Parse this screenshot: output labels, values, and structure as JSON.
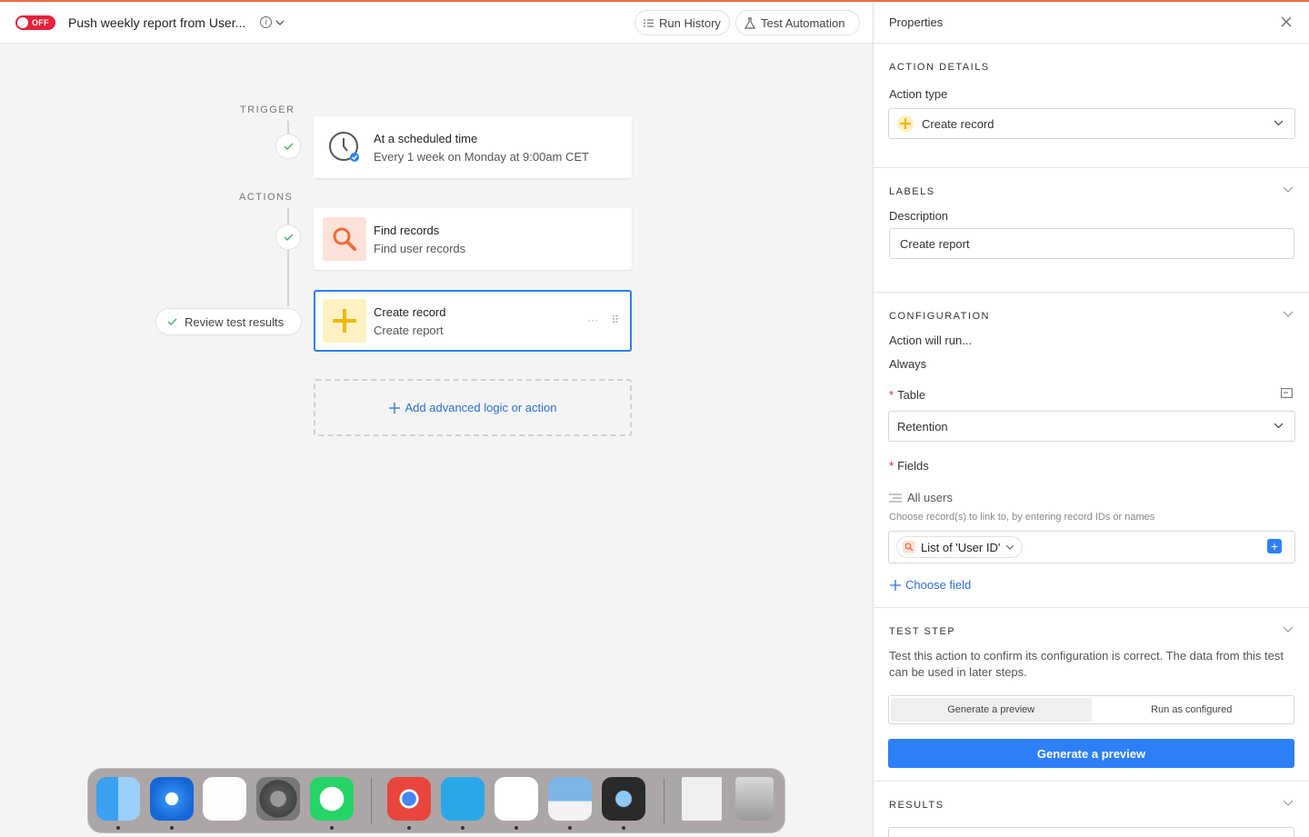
{
  "header": {
    "toggle_label": "OFF",
    "automation_title": "Push weekly report from User...",
    "run_history": "Run History",
    "test_automation": "Test Automation"
  },
  "canvas": {
    "trigger_label": "TRIGGER",
    "actions_label": "ACTIONS",
    "trigger_card": {
      "title": "At a scheduled time",
      "subtitle": "Every 1 week on Monday at 9:00am CET"
    },
    "find_card": {
      "title": "Find records",
      "subtitle": "Find user records"
    },
    "create_card": {
      "title": "Create record",
      "subtitle": "Create report"
    },
    "review_button": "Review test results",
    "add_action": "Add advanced logic or action"
  },
  "panel": {
    "title": "Properties",
    "action_details": {
      "section_title": "ACTION DETAILS",
      "action_type_label": "Action type",
      "action_type_value": "Create record"
    },
    "labels": {
      "section_title": "LABELS",
      "description_label": "Description",
      "description_value": "Create report"
    },
    "configuration": {
      "section_title": "CONFIGURATION",
      "run_label": "Action will run...",
      "run_value": "Always",
      "table_label": "Table",
      "table_value": "Retention",
      "fields_label": "Fields",
      "field_name": "All users",
      "field_hint": "Choose record(s) to link to, by entering record IDs or names",
      "chip_label": "List of 'User ID'",
      "choose_field": "Choose field"
    },
    "test_step": {
      "section_title": "TEST STEP",
      "description": "Test this action to confirm its configuration is correct. The data from this test can be used in later steps.",
      "tab_preview": "Generate a preview",
      "tab_run": "Run as configured",
      "primary_button": "Generate a preview"
    },
    "results": {
      "section_title": "RESULTS"
    }
  },
  "colors": {
    "accent": "#2d7ff9",
    "off_toggle": "#e5203a",
    "top_line": "#f26b3a",
    "find_icon_bg": "#fde2d9",
    "create_icon_bg": "#fff1c2"
  },
  "dock": {
    "apps": [
      "finder-icon",
      "safari-icon",
      "reminders-icon",
      "system-settings-icon",
      "whatsapp-icon",
      "chrome-icon",
      "clickup-icon",
      "slack-icon",
      "preview-icon",
      "quicktime-icon",
      "pdf-document-icon",
      "trash-icon"
    ]
  }
}
